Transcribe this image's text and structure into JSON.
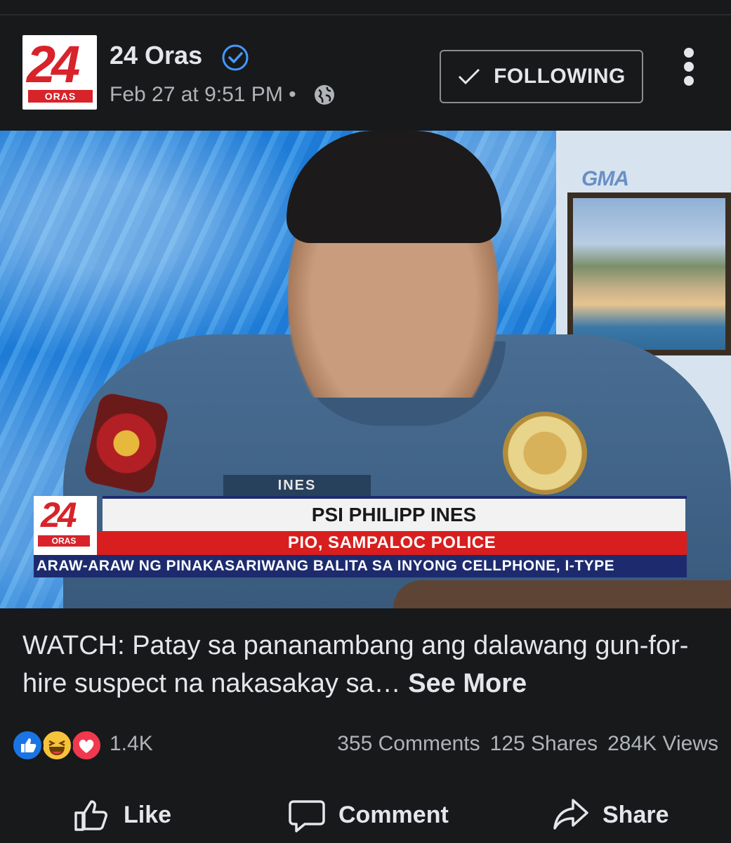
{
  "post": {
    "page_name": "24 Oras",
    "timestamp": "Feb 27 at 9:51 PM",
    "separator": "•",
    "follow_button": "FOLLOWING",
    "avatar": {
      "number": "24",
      "label": "ORAS"
    }
  },
  "media": {
    "watermark": "GMA",
    "nameplate": "INES",
    "lower_third": {
      "logo_number": "24",
      "logo_label": "ORAS",
      "name": "PSI PHILIPP INES",
      "title": "PIO, SAMPALOC POLICE",
      "ticker": "ARAW-ARAW NG PINAKASARIWANG BALITA SA INYONG CELLPHONE, I-TYPE"
    }
  },
  "caption": {
    "text": "WATCH: Patay sa pananambang ang dalawang gun-for-hire suspect na nakasakay sa…",
    "see_more": "See More"
  },
  "engagement": {
    "reactions": [
      "like-icon",
      "haha-icon",
      "love-icon"
    ],
    "reaction_count": "1.4K",
    "comments": "355 Comments",
    "shares": "125 Shares",
    "views": "284K Views"
  },
  "actions": {
    "like": "Like",
    "comment": "Comment",
    "share": "Share"
  }
}
